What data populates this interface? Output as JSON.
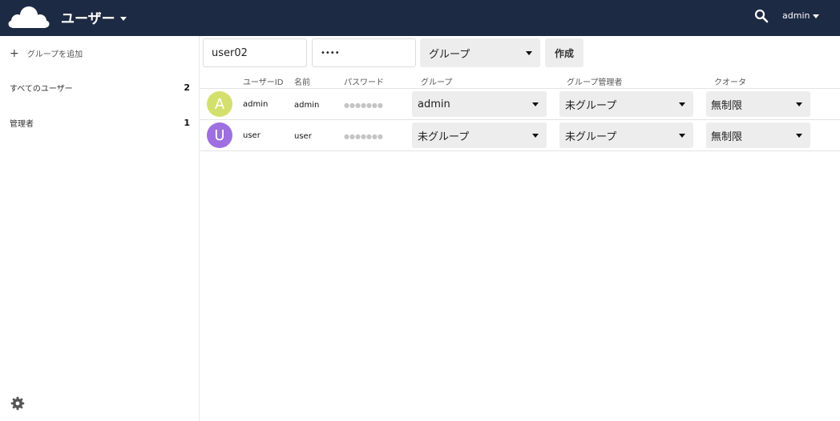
{
  "header": {
    "app_title": "ユーザー",
    "user_name": "admin",
    "bg_color": "#1d2a43"
  },
  "sidebar": {
    "add_group_label": "グループを追加",
    "items": [
      {
        "label": "すべてのユーザー",
        "count": "2"
      },
      {
        "label": "管理者",
        "count": "1"
      }
    ]
  },
  "new_user": {
    "username_value": "user02",
    "password_value": "••••",
    "group_select": "グループ",
    "create_label": "作成"
  },
  "table": {
    "columns": [
      "ユーザーID",
      "名前",
      "パスワード",
      "グループ",
      "グループ管理者",
      "クオータ"
    ],
    "rows": [
      {
        "avatar_letter": "A",
        "avatar_color": "#d4e06d",
        "user_id": "admin",
        "name": "admin",
        "password": "●●●●●●●",
        "group": "admin",
        "group_admin": "未グループ",
        "quota": "無制限"
      },
      {
        "avatar_letter": "U",
        "avatar_color": "#9e6fe0",
        "user_id": "user",
        "name": "user",
        "password": "●●●●●●●",
        "group": "未グループ",
        "group_admin": "未グループ",
        "quota": "無制限"
      }
    ]
  },
  "icons": {
    "logo": "cloud-logo-icon",
    "search": "search-icon",
    "settings": "gear-icon",
    "add": "plus-icon",
    "dropdown": "caret-down-icon"
  }
}
